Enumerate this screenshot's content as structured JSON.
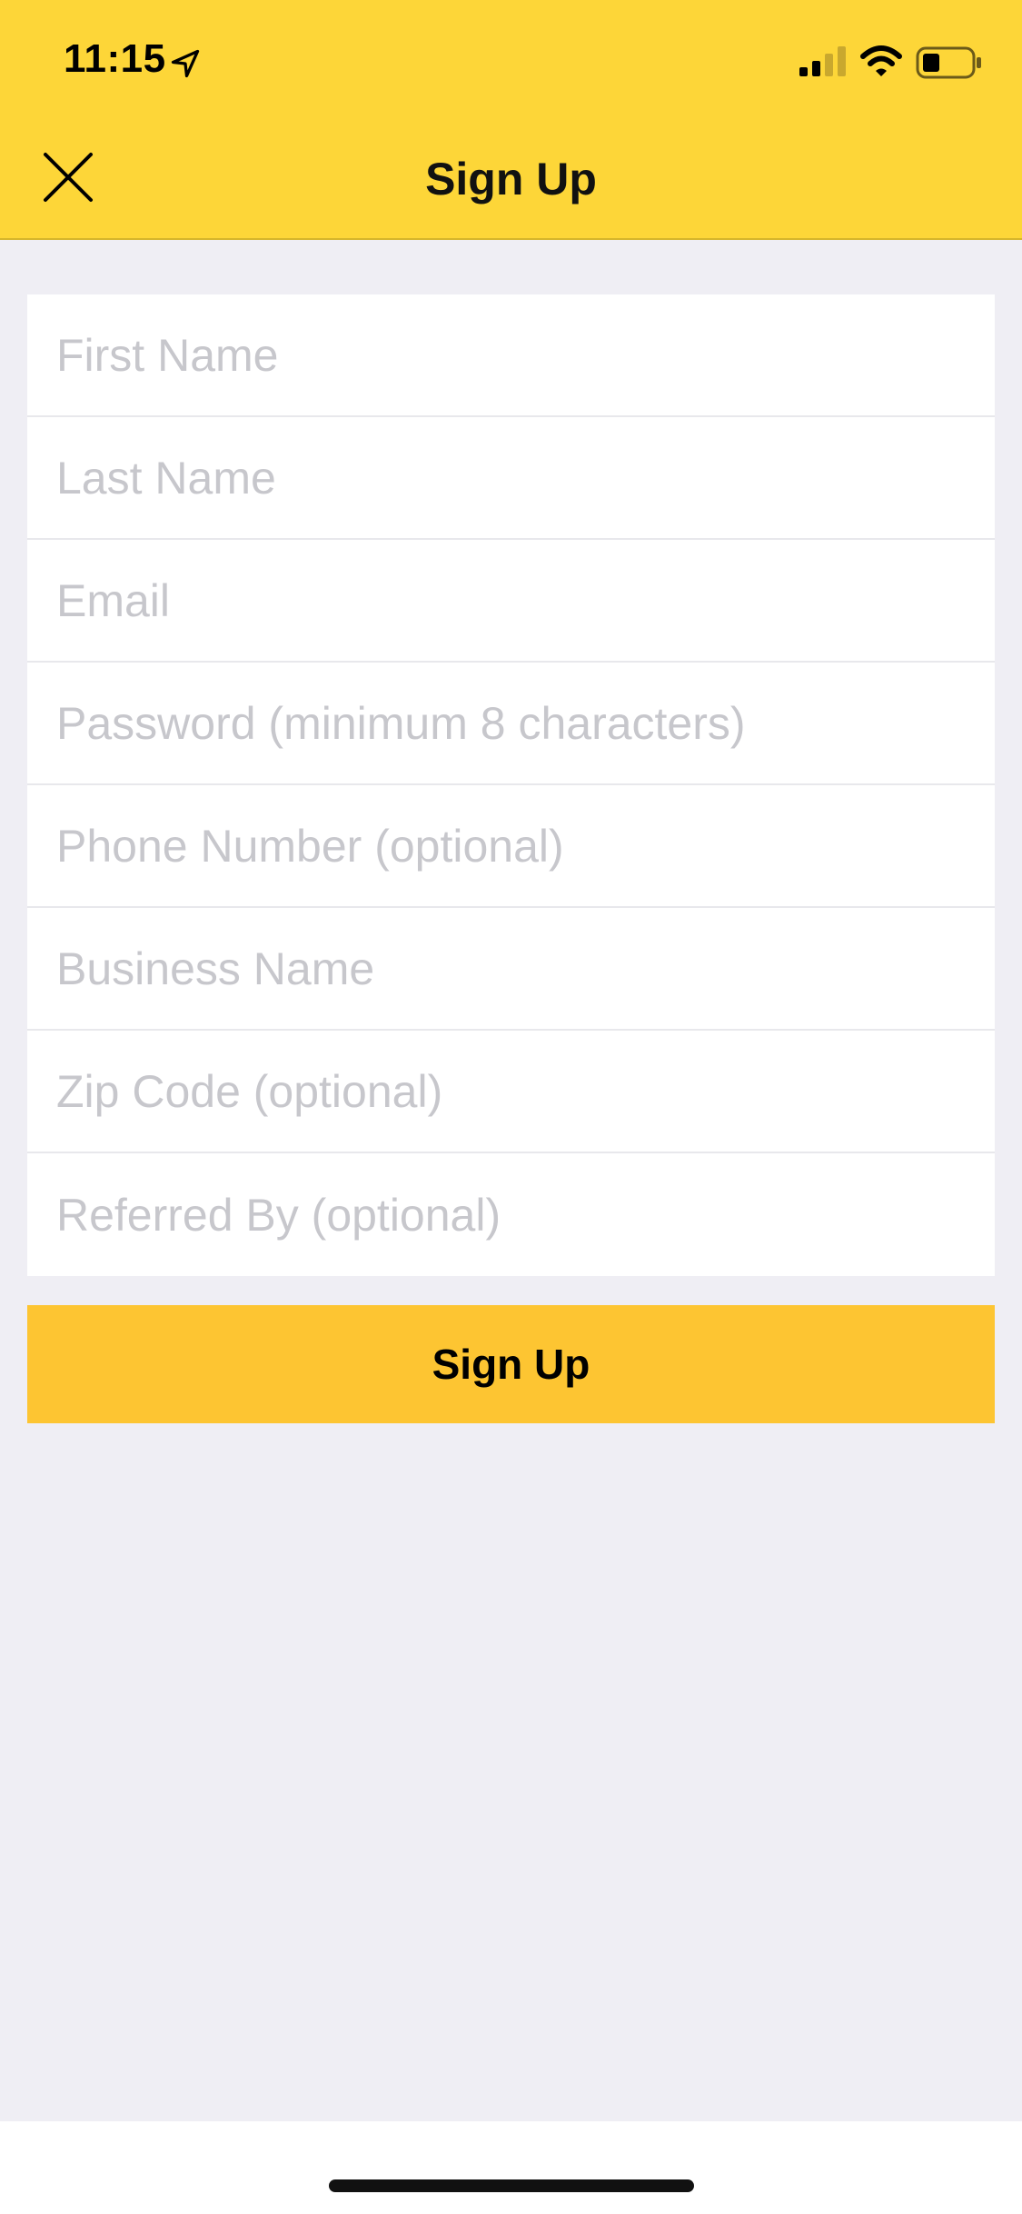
{
  "status_bar": {
    "time": "11:15",
    "icons": [
      "location-arrow-icon",
      "cellular-signal-icon",
      "wifi-icon",
      "battery-icon"
    ]
  },
  "header": {
    "title": "Sign Up",
    "close_icon": "close-icon",
    "background_color": "#fdd638"
  },
  "form": {
    "fields": [
      {
        "placeholder": "First Name",
        "value": ""
      },
      {
        "placeholder": "Last Name",
        "value": ""
      },
      {
        "placeholder": "Email",
        "value": ""
      },
      {
        "placeholder": "Password (minimum 8 characters)",
        "value": ""
      },
      {
        "placeholder": "Phone Number (optional)",
        "value": ""
      },
      {
        "placeholder": "Business Name",
        "value": ""
      },
      {
        "placeholder": "Zip Code (optional)",
        "value": ""
      },
      {
        "placeholder": "Referred By (optional)",
        "value": ""
      }
    ]
  },
  "actions": {
    "signup_label": "Sign Up",
    "signup_color": "#fdc532"
  }
}
